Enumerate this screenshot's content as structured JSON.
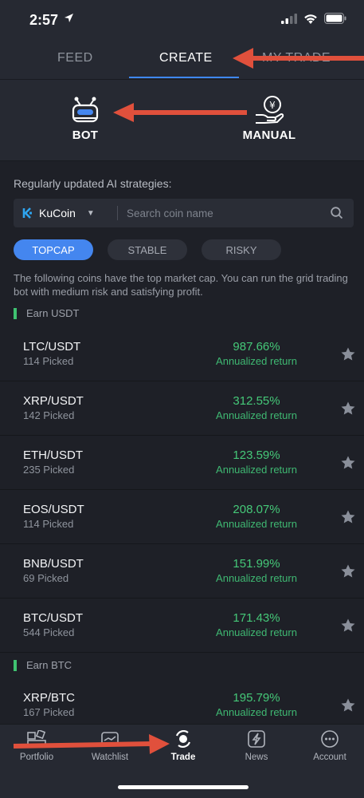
{
  "status_bar": {
    "time": "2:57"
  },
  "top_tabs": [
    {
      "label": "FEED",
      "active": false
    },
    {
      "label": "CREATE",
      "active": true
    },
    {
      "label": "MY TRADE",
      "active": false
    }
  ],
  "modes": [
    {
      "label": "BOT",
      "icon": "robot-icon"
    },
    {
      "label": "MANUAL",
      "icon": "hand-coin-icon"
    }
  ],
  "strategies_caption": "Regularly updated AI strategies:",
  "search": {
    "exchange": "KuCoin",
    "placeholder": "Search coin name"
  },
  "filters": [
    "TOPCAP",
    "STABLE",
    "RISKY"
  ],
  "description": "The following coins have the top market cap. You can run the grid trading bot with medium risk and satisfying profit.",
  "groups": [
    {
      "title": "Earn USDT",
      "rows": [
        {
          "pair": "LTC/USDT",
          "picked": "114 Picked",
          "return": "987.66%",
          "return_label": "Annualized return"
        },
        {
          "pair": "XRP/USDT",
          "picked": "142 Picked",
          "return": "312.55%",
          "return_label": "Annualized return"
        },
        {
          "pair": "ETH/USDT",
          "picked": "235 Picked",
          "return": "123.59%",
          "return_label": "Annualized return"
        },
        {
          "pair": "EOS/USDT",
          "picked": "114 Picked",
          "return": "208.07%",
          "return_label": "Annualized return"
        },
        {
          "pair": "BNB/USDT",
          "picked": "69 Picked",
          "return": "151.99%",
          "return_label": "Annualized return"
        },
        {
          "pair": "BTC/USDT",
          "picked": "544 Picked",
          "return": "171.43%",
          "return_label": "Annualized return"
        }
      ]
    },
    {
      "title": "Earn BTC",
      "rows": [
        {
          "pair": "XRP/BTC",
          "picked": "167 Picked",
          "return": "195.79%",
          "return_label": "Annualized return"
        }
      ]
    }
  ],
  "bottom_nav": [
    {
      "label": "Portfolio",
      "icon": "portfolio-icon",
      "active": false
    },
    {
      "label": "Watchlist",
      "icon": "watchlist-icon",
      "active": false
    },
    {
      "label": "Trade",
      "icon": "trade-icon",
      "active": true
    },
    {
      "label": "News",
      "icon": "news-icon",
      "active": false
    },
    {
      "label": "Account",
      "icon": "account-icon",
      "active": false
    }
  ],
  "colors": {
    "accent": "#4486ef",
    "positive": "#45c878",
    "annotation_arrow": "#e0503c",
    "background": "#1e2027"
  }
}
